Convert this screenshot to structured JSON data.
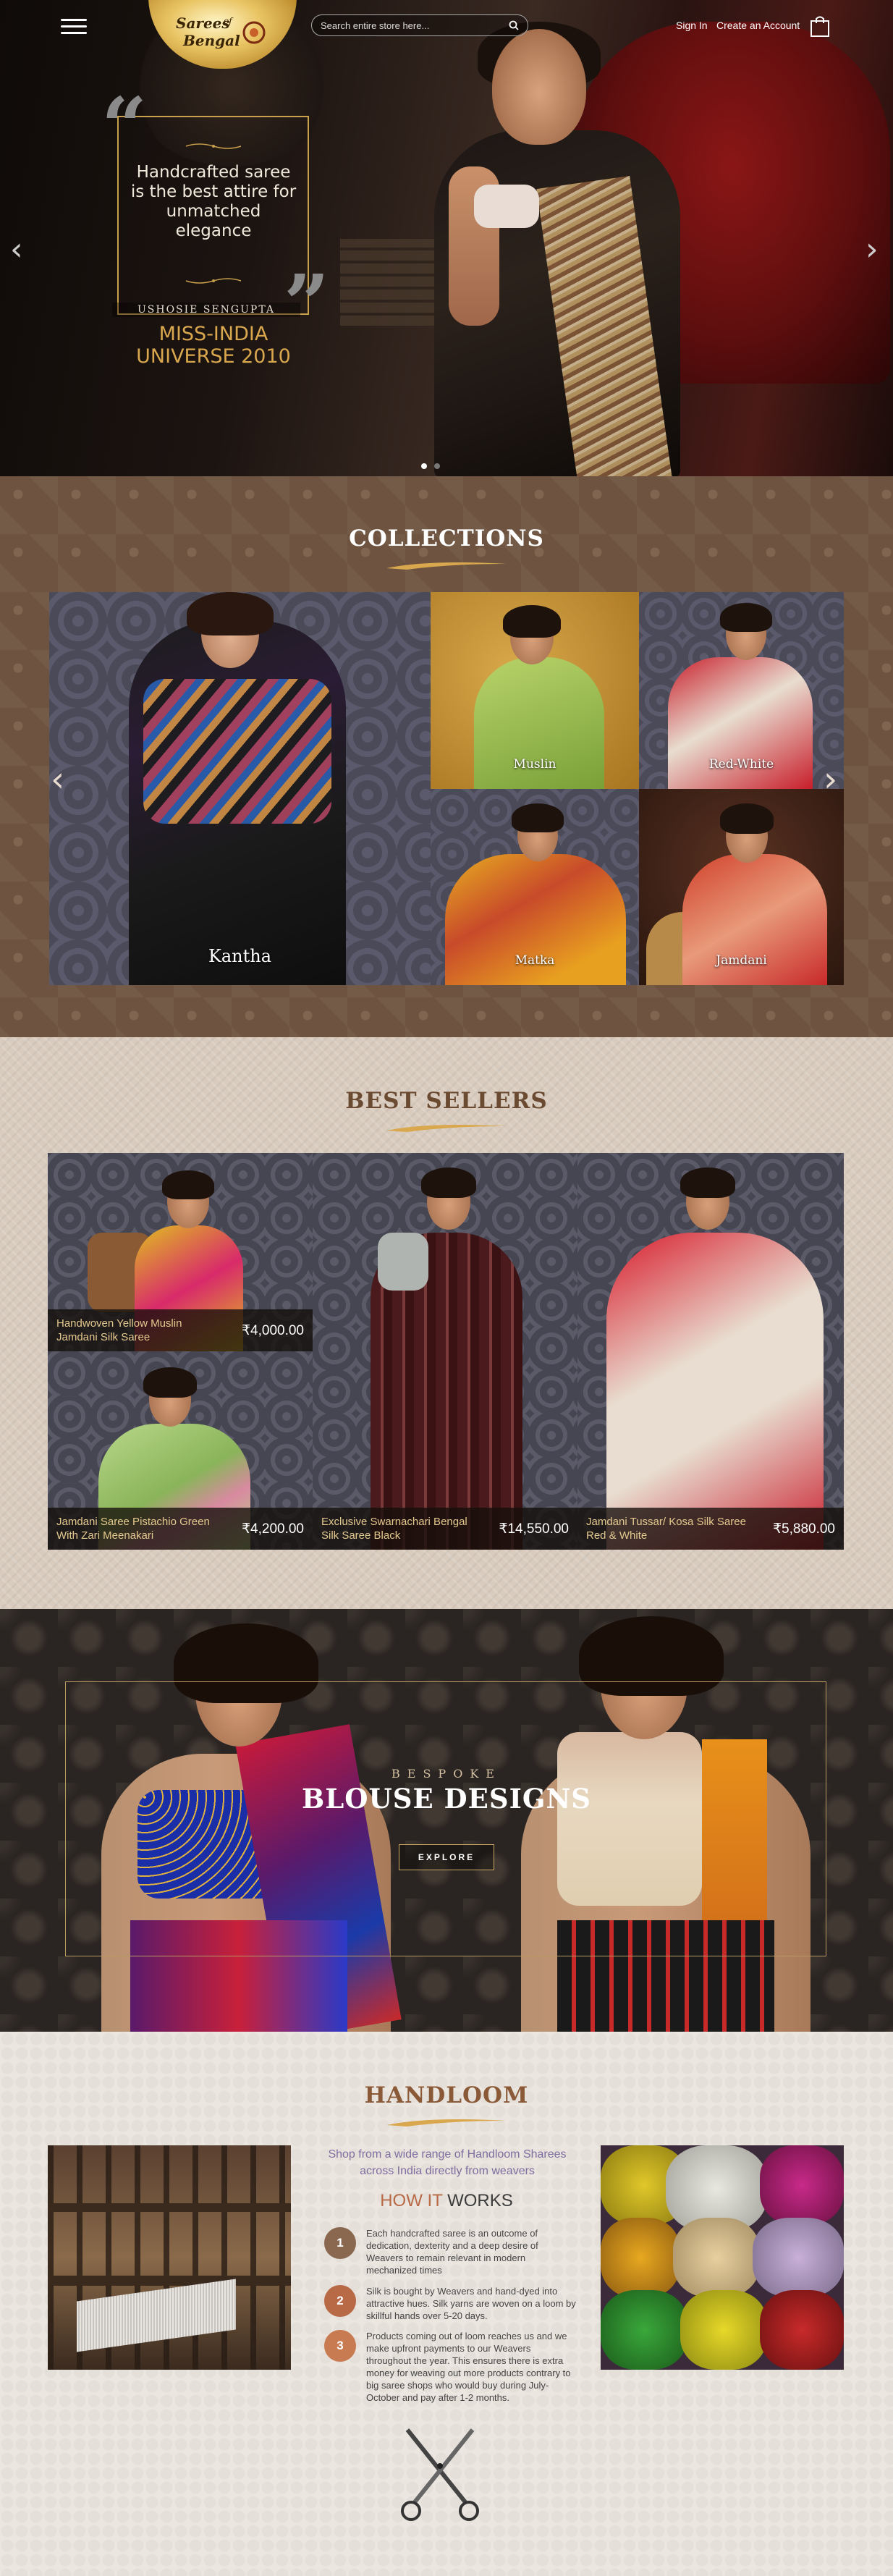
{
  "header": {
    "logo_text": "Sarees of Bengal",
    "search_placeholder": "Search entire store here...",
    "sign_in": "Sign In",
    "create_account": "Create an Account"
  },
  "hero": {
    "quote": "Handcrafted saree is the best attire for unmatched elegance",
    "author": "USHOSIE SENGUPTA",
    "title": "MISS-INDIA UNIVERSE 2010",
    "prev_arrow": "‹",
    "next_arrow": "›"
  },
  "collections": {
    "title": "COLLECTIONS",
    "items": [
      {
        "label": "Kantha"
      },
      {
        "label": "Muslin"
      },
      {
        "label": "Red-White"
      },
      {
        "label": "Matka"
      },
      {
        "label": "Jamdani"
      }
    ],
    "prev_arrow": "‹",
    "next_arrow": "›"
  },
  "bestsellers": {
    "title": "BEST SELLERS",
    "items": [
      {
        "name": "Handwoven Yellow Muslin Jamdani Silk Saree",
        "price": "₹4,000.00"
      },
      {
        "name": "Jamdani Saree Pistachio Green With Zari Meenakari",
        "price": "₹4,200.00"
      },
      {
        "name": "Exclusive Swarnachari Bengal Silk Saree Black",
        "price": "₹14,550.00"
      },
      {
        "name": "Jamdani Tussar/ Kosa Silk Saree Red & White",
        "price": "₹5,880.00"
      }
    ]
  },
  "blouse": {
    "eyebrow": "BESPOKE",
    "title": "BLOUSE DESIGNS",
    "button": "EXPLORE"
  },
  "handloom": {
    "title": "HANDLOOM",
    "subtitle": "Shop from a wide range of Handloom Sharees across India directly from weavers",
    "how_a": "HOW IT",
    "how_b": "WORKS",
    "steps": [
      {
        "num": "1",
        "text": "Each handcrafted saree is an outcome of dedication, dexterity and a deep desire of Weavers to remain relevant in modern mechanized times"
      },
      {
        "num": "2",
        "text": "Silk is bought by Weavers and hand-dyed into attractive hues. Silk yarns are woven on a loom by skillful hands over 5-20 days."
      },
      {
        "num": "3",
        "text": "Products coming out of loom reaches us and we make upfront payments to our Weavers throughout the year. This ensures there is extra money for weaving out more products contrary to big saree shops who would buy during July-October and pay after 1-2 months."
      }
    ]
  },
  "colors": {
    "gold": "#c9a04c",
    "collections_bg": "#6e5440",
    "bestsellers_title": "#6b4a32",
    "handloom_title": "#8a5a38",
    "step1": "#8a6850",
    "step2": "#b86a46",
    "step3": "#c87a50"
  }
}
